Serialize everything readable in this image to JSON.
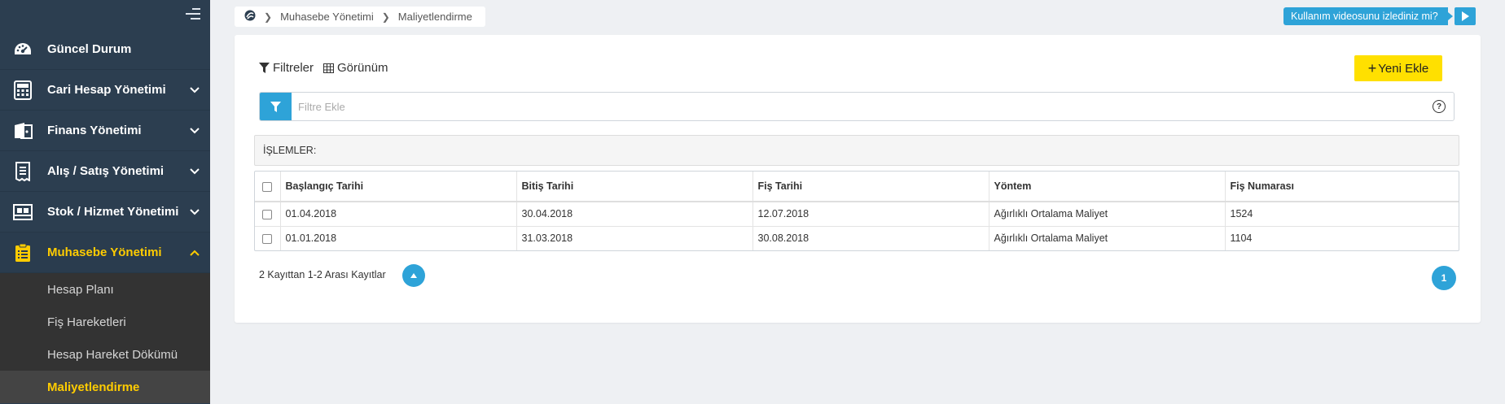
{
  "sidebar": {
    "menu": [
      {
        "label": "Güncel Durum",
        "icon": "dashboard-icon",
        "has_chevron": false
      },
      {
        "label": "Cari Hesap Yönetimi",
        "icon": "calculator-icon",
        "has_chevron": true
      },
      {
        "label": "Finans Yönetimi",
        "icon": "wallet-icon",
        "has_chevron": true
      },
      {
        "label": "Alış / Satış Yönetimi",
        "icon": "receipt-icon",
        "has_chevron": true
      },
      {
        "label": "Stok / Hizmet Yönetimi",
        "icon": "box-icon",
        "has_chevron": true
      },
      {
        "label": "Muhasebe Yönetimi",
        "icon": "clipboard-icon",
        "has_chevron": true,
        "active": true
      }
    ],
    "submenu": [
      {
        "label": "Hesap Planı"
      },
      {
        "label": "Fiş Hareketleri"
      },
      {
        "label": "Hesap Hareket Dökümü"
      },
      {
        "label": "Maliyetlendirme",
        "active": true
      }
    ]
  },
  "breadcrumb": {
    "items": [
      "Muhasebe Yönetimi",
      "Maliyetlendirme"
    ]
  },
  "help": {
    "label": "Kullanım videosunu izlediniz mi?"
  },
  "toolbar": {
    "filters_label": "Filtreler",
    "view_label": "Görünüm",
    "new_label": "Yeni Ekle"
  },
  "filter": {
    "placeholder": "Filtre Ekle"
  },
  "operations": {
    "label": "İŞLEMLER:"
  },
  "table": {
    "columns": [
      "Başlangıç Tarihi",
      "Bitiş Tarihi",
      "Fiş Tarihi",
      "Yöntem",
      "Fiş Numarası"
    ],
    "rows": [
      [
        "01.04.2018",
        "30.04.2018",
        "12.07.2018",
        "Ağırlıklı Ortalama Maliyet",
        "1524"
      ],
      [
        "01.01.2018",
        "31.03.2018",
        "30.08.2018",
        "Ağırlıklı Ortalama Maliyet",
        "1104"
      ]
    ]
  },
  "footer": {
    "records_text": "2 Kayıttan 1-2 Arası Kayıtlar",
    "page": "1"
  },
  "colors": {
    "sidebar_bg": "#2c3e50",
    "accent": "#2ea3d8",
    "active_yellow": "#ffcc00",
    "new_button": "#ffe000"
  }
}
